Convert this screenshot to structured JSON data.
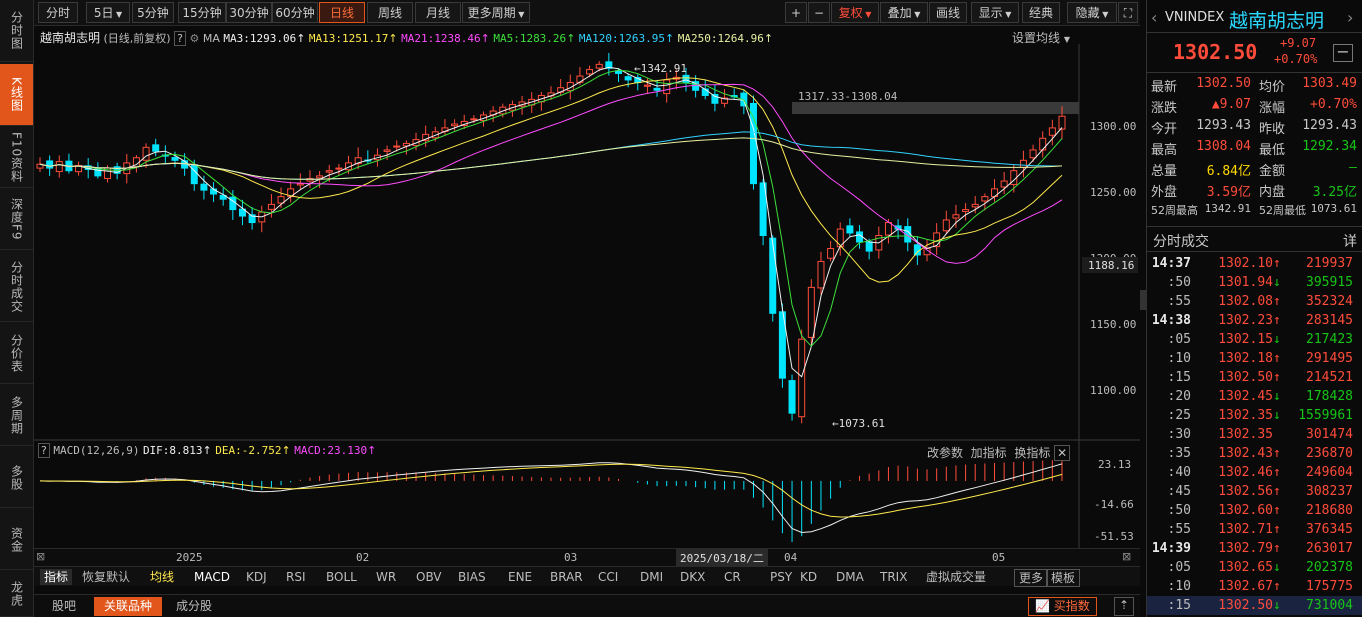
{
  "left_tabs": [
    "分时图",
    "K线图",
    "F10资料",
    "深度F9",
    "分时成交",
    "分价表",
    "多周期",
    "多股",
    "资金",
    "龙虎"
  ],
  "toolbar": {
    "periods": [
      "分时",
      "5日",
      "5分钟",
      "15分钟",
      "30分钟",
      "60分钟",
      "日线",
      "周线",
      "月线",
      "更多周期"
    ],
    "tools": [
      "+",
      "−",
      "复权",
      "叠加",
      "画线",
      "显示",
      "经典",
      "隐藏"
    ]
  },
  "chart_header": {
    "name": "越南胡志明",
    "sub": "(日线,前复权)",
    "ma": "MA",
    "ma3": "MA3:1293.06",
    "ma13": "MA13:1251.17",
    "ma21": "MA21:1238.46",
    "ma5": "MA5:1283.26",
    "ma120": "MA120:1263.95",
    "ma250": "MA250:1264.96",
    "settings": "设置均线"
  },
  "annotations": {
    "high": "←1342.91",
    "low": "←1073.61",
    "range": "1317.33-1308.04",
    "last": "1188.16"
  },
  "price_axis": [
    "1300.00",
    "1250.00",
    "1200.00",
    "1150.00",
    "1100.00"
  ],
  "macd_header": {
    "name": "MACD(12,26,9)",
    "dif": "DIF:8.813",
    "dea": "DEA:-2.752",
    "macd": "MACD:23.130",
    "opt1": "改参数",
    "opt2": "加指标",
    "opt3": "换指标"
  },
  "macd_axis": [
    "23.13",
    "-14.66",
    "-51.53"
  ],
  "date_axis": [
    "2025",
    "02",
    "03",
    "2025/03/18/二",
    "04",
    "05"
  ],
  "indicators": [
    "指标",
    "恢复默认",
    "均线",
    "MACD",
    "KDJ",
    "RSI",
    "BOLL",
    "WR",
    "OBV",
    "BIAS",
    "ENE",
    "BRAR",
    "CCI",
    "DMI",
    "DKX",
    "CR",
    "PSY",
    "KD",
    "DMA",
    "TRIX",
    "虚拟成交量",
    "更多",
    "模板"
  ],
  "bottom_tabs": [
    "股吧",
    "关联品种",
    "成分股"
  ],
  "bottom_right": "",
  "quote": {
    "code": "VNINDEX",
    "name": "越南胡志明",
    "price": "1302.50",
    "chg": "+9.07",
    "pct": "+0.70%",
    "rows": [
      [
        "最新",
        "1302.50",
        "均价",
        "1303.49"
      ],
      [
        "涨跌",
        "▲9.07",
        "涨幅",
        "+0.70%"
      ],
      [
        "今开",
        "1293.43",
        "昨收",
        "1293.43"
      ],
      [
        "最高",
        "1308.04",
        "最低",
        "1292.34"
      ],
      [
        "总量",
        "6.84亿",
        "金额",
        "—"
      ],
      [
        "外盘",
        "3.59亿",
        "内盘",
        "3.25亿"
      ],
      [
        "52周最高",
        "1342.91",
        "52周最低",
        "1073.61"
      ]
    ]
  },
  "ticks_title": "分时成交",
  "ticks_detail": "详",
  "ticks": [
    {
      "t": "14:37",
      "p": "1302.10",
      "d": "up",
      "v": "219937",
      "vc": "up"
    },
    {
      "t": ":50",
      "p": "1301.94",
      "d": "down",
      "v": "395915",
      "vc": "dn"
    },
    {
      "t": ":55",
      "p": "1302.08",
      "d": "up",
      "v": "352324",
      "vc": "up"
    },
    {
      "t": "14:38",
      "p": "1302.23",
      "d": "up",
      "v": "283145",
      "vc": "up"
    },
    {
      "t": ":05",
      "p": "1302.15",
      "d": "down",
      "v": "217423",
      "vc": "dn"
    },
    {
      "t": ":10",
      "p": "1302.18",
      "d": "up",
      "v": "291495",
      "vc": "up"
    },
    {
      "t": ":15",
      "p": "1302.50",
      "d": "up",
      "v": "214521",
      "vc": "up"
    },
    {
      "t": ":20",
      "p": "1302.45",
      "d": "down",
      "v": "178428",
      "vc": "dn"
    },
    {
      "t": ":25",
      "p": "1302.35",
      "d": "down",
      "v": "1559961",
      "vc": "dn"
    },
    {
      "t": ":30",
      "p": "1302.35",
      "d": "",
      "v": "301474",
      "vc": "up"
    },
    {
      "t": ":35",
      "p": "1302.43",
      "d": "up",
      "v": "236870",
      "vc": "up"
    },
    {
      "t": ":40",
      "p": "1302.46",
      "d": "up",
      "v": "249604",
      "vc": "up"
    },
    {
      "t": ":45",
      "p": "1302.56",
      "d": "up",
      "v": "308237",
      "vc": "up"
    },
    {
      "t": ":50",
      "p": "1302.60",
      "d": "up",
      "v": "218680",
      "vc": "up"
    },
    {
      "t": ":55",
      "p": "1302.71",
      "d": "up",
      "v": "376345",
      "vc": "up"
    },
    {
      "t": "14:39",
      "p": "1302.79",
      "d": "up",
      "v": "263017",
      "vc": "up"
    },
    {
      "t": ":05",
      "p": "1302.65",
      "d": "down",
      "v": "202378",
      "vc": "dn"
    },
    {
      "t": ":10",
      "p": "1302.67",
      "d": "up",
      "v": "175775",
      "vc": "up"
    },
    {
      "t": ":15",
      "p": "1302.50",
      "d": "down",
      "v": "731004",
      "vc": "dn"
    }
  ],
  "colors": {
    "up": "#ff4c3b",
    "down": "#17c517",
    "cyan": "#00e5ff",
    "accent": "#e2561c"
  },
  "chart_data": {
    "type": "candlestick",
    "ylim": [
      1060,
      1350
    ],
    "closes": [
      1265,
      1262,
      1267,
      1260,
      1264,
      1261,
      1256,
      1262,
      1258,
      1266,
      1270,
      1278,
      1275,
      1272,
      1268,
      1262,
      1250,
      1245,
      1242,
      1238,
      1230,
      1225,
      1220,
      1228,
      1234,
      1240,
      1246,
      1250,
      1254,
      1256,
      1260,
      1262,
      1266,
      1270,
      1268,
      1272,
      1276,
      1279,
      1281,
      1284,
      1288,
      1290,
      1293,
      1296,
      1298,
      1300,
      1303,
      1306,
      1309,
      1311,
      1313,
      1315,
      1318,
      1320,
      1324,
      1328,
      1333,
      1338,
      1342,
      1339,
      1335,
      1330,
      1328,
      1326,
      1322,
      1330,
      1332,
      1328,
      1322,
      1318,
      1312,
      1316,
      1317,
      1310,
      1250,
      1210,
      1150,
      1100,
      1073,
      1130,
      1170,
      1190,
      1200,
      1215,
      1212,
      1205,
      1198,
      1210,
      1220,
      1215,
      1205,
      1195,
      1200,
      1212,
      1222,
      1226,
      1230,
      1234,
      1240,
      1246,
      1252,
      1260,
      1268,
      1276,
      1285,
      1293,
      1302
    ]
  }
}
